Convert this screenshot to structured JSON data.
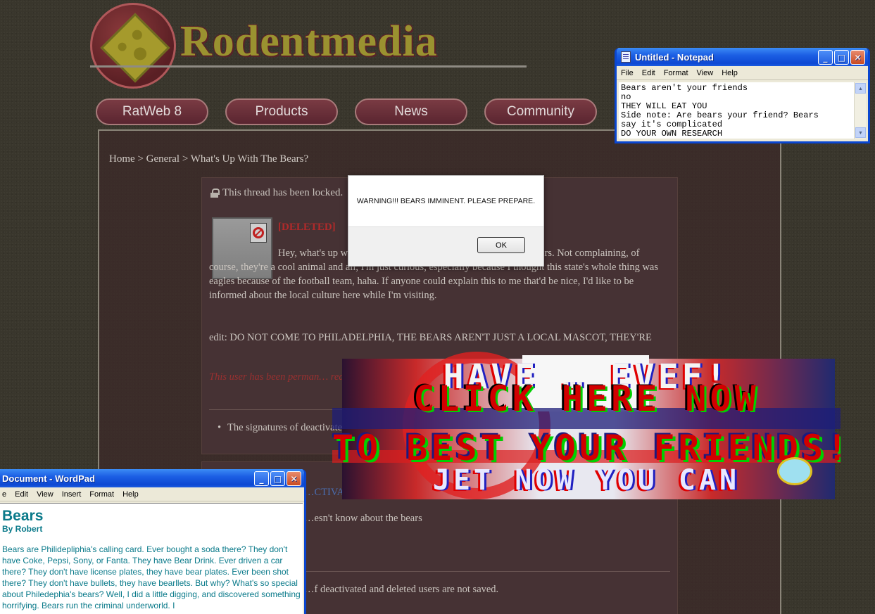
{
  "site": {
    "logo_text": "Rodentmedia",
    "nav": [
      "RatWeb 8",
      "Products",
      "News",
      "Community"
    ]
  },
  "breadcrumb": "Home > General > What's Up With The Bears?",
  "thread": {
    "locked_notice": "This thread has been locked.",
    "post1": {
      "username": "[DELETED]",
      "body": "Hey, what's up w… …phia and there's a lot of stuff related to bears. Not complaining, of course, they're a cool animal and all, I'm just curious, especially because I thought this state's whole thing was eagles because of the football team, haha. If anyone could explain this to me that'd be nice, I'd like to be informed about the local culture here while I'm visiting.",
      "edit": "edit: DO NOT COME TO PHILADELPHIA, THE BEARS AREN'T JUST A LOCAL MASCOT, THEY'RE",
      "ban_note": "This user has been perman… read the rules before posting…",
      "signature_note": "The signatures of deactivated and … …ot saved."
    },
    "post2": {
      "username": "…CTIVATED]",
      "body": "…esn't know about the bears",
      "signature_note": "…f deactivated and deleted users are not saved."
    }
  },
  "alert": {
    "message": "WARNING!!! BEARS IMMINENT. PLEASE PREPARE.",
    "ok_label": "OK"
  },
  "notepad": {
    "title": "Untitled - Notepad",
    "menu": [
      "File",
      "Edit",
      "Format",
      "View",
      "Help"
    ],
    "text": "Bears aren't your friends\nno\nTHEY WILL EAT YOU\nSide note: Are bears your friend? Bears\nsay it's complicated\nDO YOUR OWN RESEARCH"
  },
  "wordpad": {
    "title": "Document - WordPad",
    "menu": [
      "e",
      "Edit",
      "View",
      "Insert",
      "Format",
      "Help"
    ],
    "doc_title": "Bears",
    "doc_byline": "By Robert",
    "doc_body": "Bears are Philidepliphia's calling card. Ever bought a soda there? They don't have Coke, Pepsi, Sony, or Fanta. They have Bear Drink. Ever driven a car there? They don't have license plates, they have bear plates. Ever been shot there? They don't have bullets, they have bearllets. But why? What's so special about Philedephia's bears? Well, I did a little digging, and discovered something horrifying. Bears run the criminal underworld. I"
  },
  "ad": {
    "line_top": "HAVE … EVEF!",
    "line_mid": "CLICK HERE NOW",
    "line_hi": "TO BEST YOUR FRIENDS!!",
    "line_sub": "JET NOW YOU CAN"
  },
  "colors": {
    "page_bg": "#39362c",
    "site_accent": "#5a2530",
    "logo_gold": "#9a9230",
    "xp_title_blue": "#0d48d3",
    "wordpad_text": "#0a7a8a",
    "deleted_user": "#b02a2a"
  }
}
